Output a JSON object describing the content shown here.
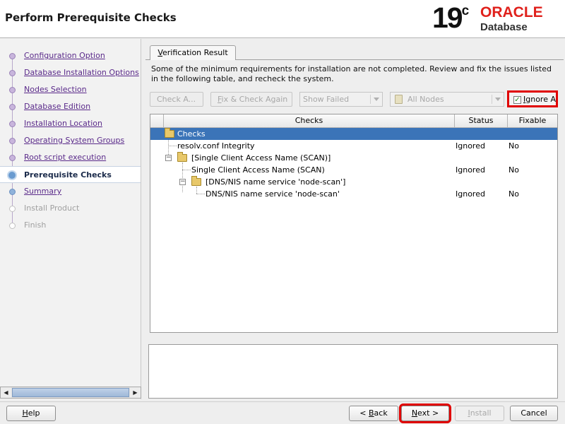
{
  "header": {
    "title": "Perform Prerequisite Checks",
    "logo_version": "19",
    "logo_version_sup": "c",
    "logo_brand": "ORACLE",
    "logo_product": "Database"
  },
  "nav": {
    "items": [
      {
        "label": "Configuration Option",
        "state": "link"
      },
      {
        "label": "Database Installation Options",
        "state": "link"
      },
      {
        "label": "Nodes Selection",
        "state": "link"
      },
      {
        "label": "Database Edition",
        "state": "link"
      },
      {
        "label": "Installation Location",
        "state": "link"
      },
      {
        "label": "Operating System Groups",
        "state": "link"
      },
      {
        "label": "Root script execution",
        "state": "link"
      },
      {
        "label": "Prerequisite Checks",
        "state": "active"
      },
      {
        "label": "Summary",
        "state": "link"
      },
      {
        "label": "Install Product",
        "state": "disabled"
      },
      {
        "label": "Finish",
        "state": "disabled"
      }
    ]
  },
  "tab": {
    "label_accel": "V",
    "label_rest": "erification Result"
  },
  "description": "Some of the minimum requirements for installation are not completed. Review and fix the issues listed in the following table, and recheck the system.",
  "toolbar": {
    "check_again": "Check A...",
    "fix_accel": "F",
    "fix_rest": "ix & Check Again",
    "show_filter": "Show Failed",
    "nodes_filter": "All Nodes",
    "ignore_accel": "I",
    "ignore_rest": "gnore A",
    "ignore_checked": true
  },
  "table": {
    "headers": [
      "Checks",
      "Status",
      "Fixable"
    ],
    "rows": [
      {
        "check": "Checks",
        "status": "",
        "fixable": ""
      },
      {
        "check": "resolv.conf Integrity",
        "status": "Ignored",
        "fixable": "No"
      },
      {
        "check": "[Single Client Access Name (SCAN)]",
        "status": "",
        "fixable": ""
      },
      {
        "check": "Single Client Access Name (SCAN)",
        "status": "Ignored",
        "fixable": "No"
      },
      {
        "check": "[DNS/NIS name service 'node-scan']",
        "status": "",
        "fixable": ""
      },
      {
        "check": "DNS/NIS name service 'node-scan'",
        "status": "Ignored",
        "fixable": "No"
      }
    ]
  },
  "buttons": {
    "help_accel": "H",
    "help_rest": "elp",
    "back_prefix": "< ",
    "back_accel": "B",
    "back_rest": "ack",
    "next_accel": "N",
    "next_rest": "ext >",
    "install_accel": "I",
    "install_rest": "nstall",
    "cancel": "Cancel"
  },
  "colors": {
    "accent": "#3b74b8",
    "highlight": "#e00000",
    "brand": "#e0211c"
  }
}
